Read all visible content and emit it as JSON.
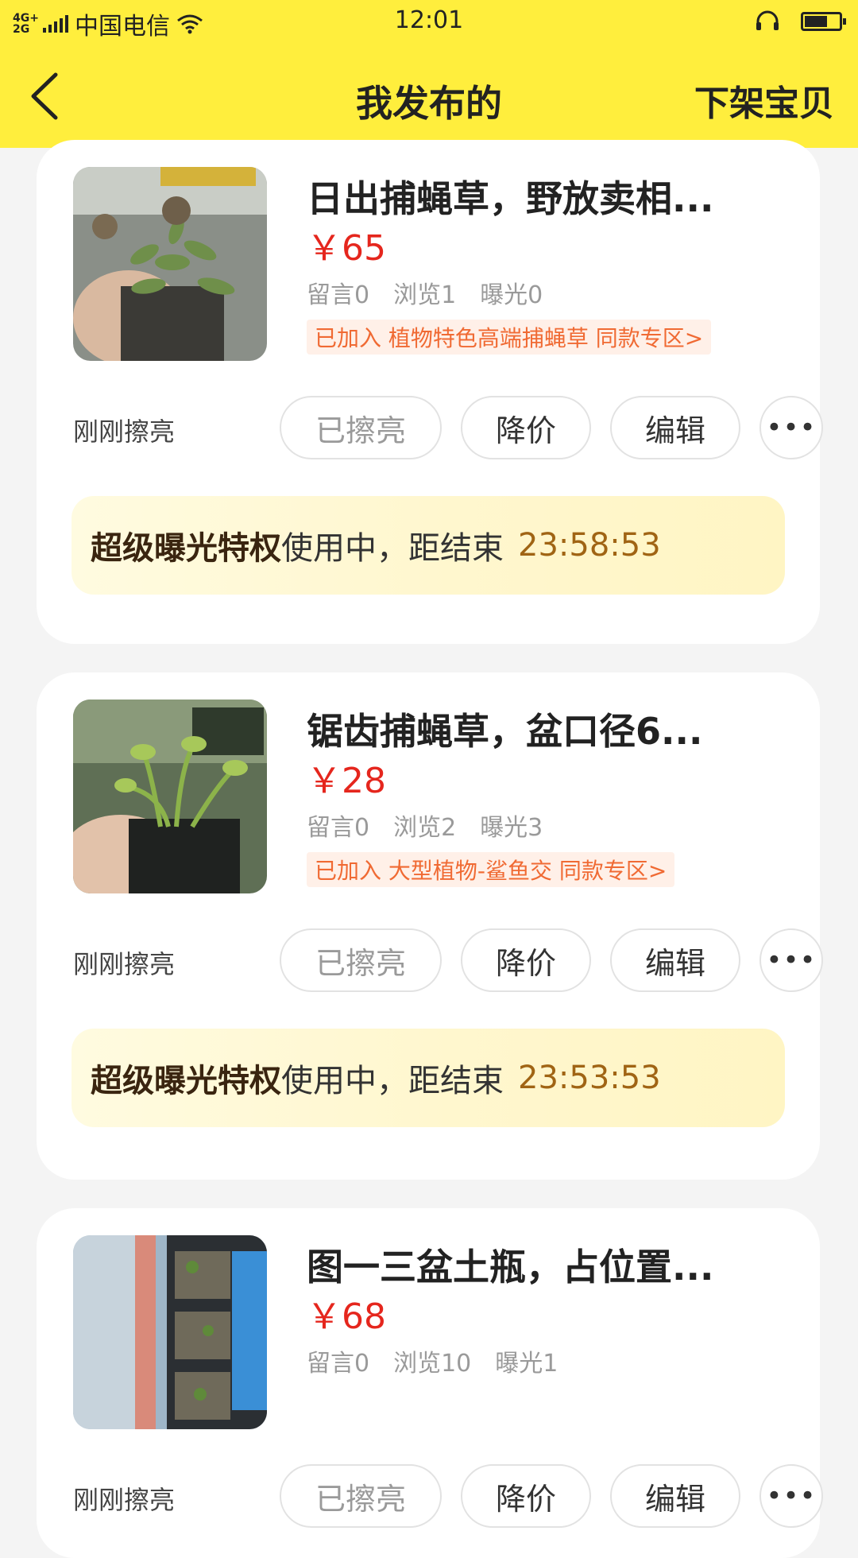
{
  "status_bar": {
    "network": "4G+ 2G",
    "carrier": "中国电信",
    "time": "12:01"
  },
  "header": {
    "title": "我发布的",
    "action": "下架宝贝"
  },
  "listings": [
    {
      "title": "日出捕蝇草，野放卖相...",
      "price": "￥65",
      "stats": [
        "留言0",
        "浏览1",
        "曝光0"
      ],
      "tag": "已加入 植物特色高端捕蝇草 同款专区>",
      "refreshed": "刚刚擦亮",
      "buttons": {
        "refreshed": "已擦亮",
        "price_cut": "降价",
        "edit": "编辑",
        "more": "•••"
      },
      "banner": {
        "strong": "超级曝光特权",
        "text": "使用中，距结束",
        "countdown": "23:58:53"
      }
    },
    {
      "title": "锯齿捕蝇草，盆口径6...",
      "price": "￥28",
      "stats": [
        "留言0",
        "浏览2",
        "曝光3"
      ],
      "tag": "已加入 大型植物-鲨鱼交 同款专区>",
      "refreshed": "刚刚擦亮",
      "buttons": {
        "refreshed": "已擦亮",
        "price_cut": "降价",
        "edit": "编辑",
        "more": "•••"
      },
      "banner": {
        "strong": "超级曝光特权",
        "text": "使用中，距结束",
        "countdown": "23:53:53"
      }
    },
    {
      "title": "图一三盆土瓶，占位置...",
      "price": "￥68",
      "stats": [
        "留言0",
        "浏览10",
        "曝光1"
      ],
      "refreshed": "刚刚擦亮",
      "buttons": {
        "refreshed": "已擦亮",
        "price_cut": "降价",
        "edit": "编辑",
        "more": "•••"
      }
    }
  ],
  "colors": {
    "header_bg": "#ffee3d",
    "price": "#e5261d",
    "tag": "#f06a33",
    "countdown": "#a06414"
  }
}
